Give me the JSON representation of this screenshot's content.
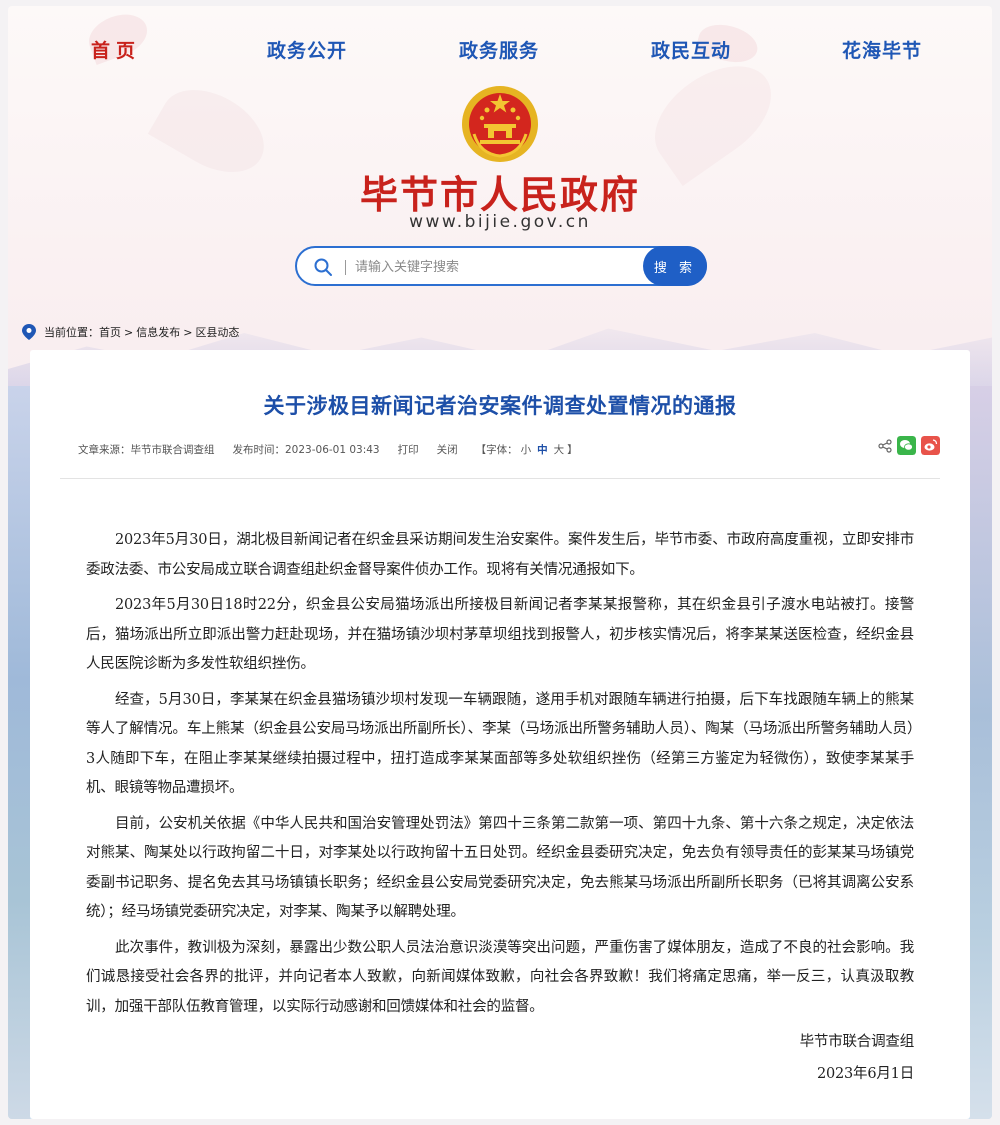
{
  "nav": {
    "items": [
      {
        "label": "首页"
      },
      {
        "label": "政务公开"
      },
      {
        "label": "政务服务"
      },
      {
        "label": "政民互动"
      },
      {
        "label": "花海毕节"
      }
    ]
  },
  "site": {
    "title": "毕节市人民政府",
    "url": "www.bijie.gov.cn"
  },
  "search": {
    "placeholder": "请输入关键字搜索",
    "button": "搜 索"
  },
  "breadcrumb": {
    "prefix": "当前位置：",
    "items": [
      "首页",
      "信息发布",
      "区县动态"
    ],
    "sep": ">"
  },
  "article": {
    "title": "关于涉极目新闻记者治安案件调查处置情况的通报",
    "source": "文章来源：毕节市联合调查组",
    "published": "发布时间：2023-06-01 03:43",
    "print": "打印",
    "close": "关闭",
    "font_label": "【字体：",
    "font_small": "小",
    "font_medium": "中",
    "font_large": "大",
    "font_end": "】",
    "paragraphs": [
      "2023年5月30日，湖北极目新闻记者在织金县采访期间发生治安案件。案件发生后，毕节市委、市政府高度重视，立即安排市委政法委、市公安局成立联合调查组赴织金督导案件侦办工作。现将有关情况通报如下。",
      "2023年5月30日18时22分，织金县公安局猫场派出所接极目新闻记者李某某报警称，其在织金县引子渡水电站被打。接警后，猫场派出所立即派出警力赶赴现场，并在猫场镇沙坝村茅草坝组找到报警人，初步核实情况后，将李某某送医检查，经织金县人民医院诊断为多发性软组织挫伤。",
      "经查，5月30日，李某某在织金县猫场镇沙坝村发现一车辆跟随，遂用手机对跟随车辆进行拍摄，后下车找跟随车辆上的熊某等人了解情况。车上熊某（织金县公安局马场派出所副所长）、李某（马场派出所警务辅助人员）、陶某（马场派出所警务辅助人员）3人随即下车，在阻止李某某继续拍摄过程中，扭打造成李某某面部等多处软组织挫伤（经第三方鉴定为轻微伤），致使李某某手机、眼镜等物品遭损坏。",
      "目前，公安机关依据《中华人民共和国治安管理处罚法》第四十三条第二款第一项、第四十九条、第十六条之规定，决定依法对熊某、陶某处以行政拘留二十日，对李某处以行政拘留十五日处罚。经织金县委研究决定，免去负有领导责任的彭某某马场镇党委副书记职务、提名免去其马场镇镇长职务；经织金县公安局党委研究决定，免去熊某马场派出所副所长职务（已将其调离公安系统）；经马场镇党委研究决定，对李某、陶某予以解聘处理。",
      "此次事件，教训极为深刻，暴露出少数公职人员法治意识淡漠等突出问题，严重伤害了媒体朋友，造成了不良的社会影响。我们诚恳接受社会各界的批评，并向记者本人致歉，向新闻媒体致歉，向社会各界致歉！我们将痛定思痛，举一反三，认真汲取教训，加强干部队伍教育管理，以实际行动感谢和回馈媒体和社会的监督。"
    ],
    "signature": "毕节市联合调查组",
    "date": "2023年6月1日"
  },
  "colors": {
    "nav_active": "#c8221c",
    "nav": "#1f57b5",
    "title": "#1d4fa8",
    "search_button": "#1f5fc6",
    "wechat": "#3ab54a",
    "weibo": "#e8534a"
  },
  "icons": [
    "national-emblem-icon",
    "search-icon",
    "location-pin-icon",
    "share-icon",
    "wechat-icon",
    "weibo-icon"
  ]
}
